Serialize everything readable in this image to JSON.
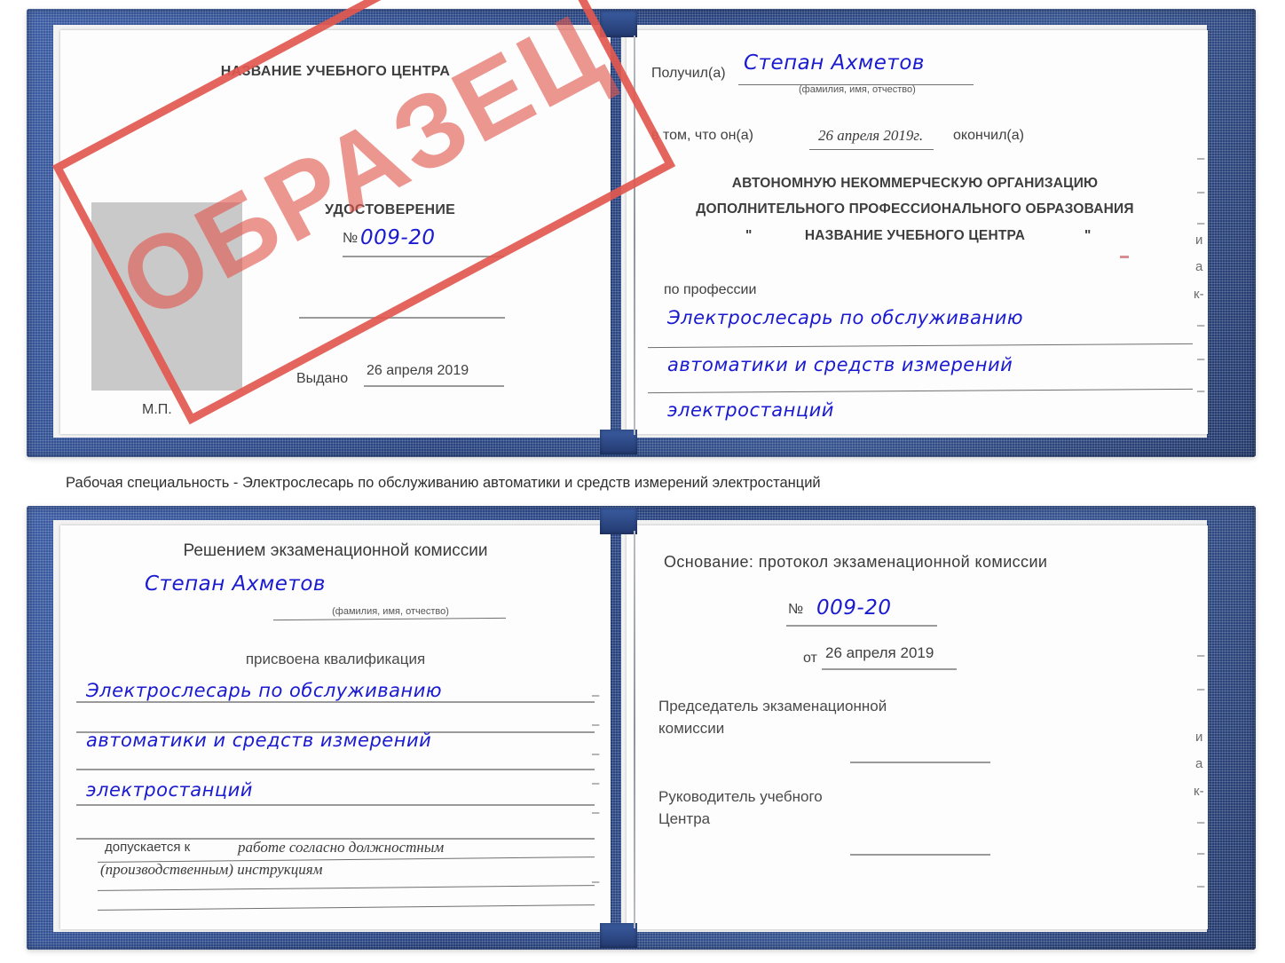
{
  "caption": "Рабочая специальность - Электрослесарь по обслуживанию автоматики и средств измерений электростанций",
  "stamp": {
    "text": "ОБРАЗЕЦ",
    "color": "#e2584f"
  },
  "colors": {
    "cover": "#2e4d8e",
    "handwriting": "#1a1ad0",
    "page": "#fdfdfd",
    "photo_placeholder": "#c9c9c9"
  },
  "doc_top": {
    "left_page": {
      "center_name": "НАЗВАНИЕ УЧЕБНОГО ЦЕНТРА",
      "title": "УДОСТОВЕРЕНИЕ",
      "number_label": "№",
      "number_value": "009-20",
      "issued_label": "Выдано",
      "issued_value": "26 апреля 2019",
      "seal_label": "М.П.",
      "photo_label": "photo-placeholder"
    },
    "right_page": {
      "received_label": "Получил(а)",
      "received_value": "Степан Ахметов",
      "fio_hint": "(фамилия, имя, отчество)",
      "in_that_label": "в том, что он(а)",
      "date_value": "26 апреля 2019г.",
      "finished_label": "окончил(а)",
      "org_line1": "АВТОНОМНУЮ НЕКОММЕРЧЕСКУЮ ОРГАНИЗАЦИЮ",
      "org_line2": "ДОПОЛНИТЕЛЬНОГО ПРОФЕССИОНАЛЬНОГО ОБРАЗОВАНИЯ",
      "org_quote_open": "\"",
      "org_line3": "НАЗВАНИЕ УЧЕБНОГО ЦЕНТРА",
      "org_quote_close": "\"",
      "profession_label": "по профессии",
      "profession_line1": "Электрослесарь по обслуживанию",
      "profession_line2": "автоматики и средств измерений",
      "profession_line3": "электростанций",
      "edge_marks": [
        "–",
        "–",
        "–",
        "и",
        "а",
        "к-",
        "–",
        "–",
        "–"
      ]
    }
  },
  "doc_bottom": {
    "left_page": {
      "decision_title": "Решением экзаменационной комиссии",
      "name_value": "Степан Ахметов",
      "fio_hint": "(фамилия, имя, отчество)",
      "qualification_label": "присвоена квалификация",
      "qualification_line1": "Электрослесарь по обслуживанию",
      "qualification_line2": "автоматики и средств измерений",
      "qualification_line3": "электростанций",
      "allowed_label": "допускается к",
      "allowed_value1": "работе согласно должностным",
      "allowed_value2": "(производственным) инструкциям"
    },
    "right_page": {
      "basis_label": "Основание: протокол экзаменационной комиссии",
      "number_label": "№",
      "number_value": "009-20",
      "from_label": "от",
      "from_value": "26 апреля 2019",
      "chairman_line1": "Председатель экзаменационной",
      "chairman_line2": "комиссии",
      "head_line1": "Руководитель учебного",
      "head_line2": "Центра",
      "edge_marks": [
        "–",
        "–",
        "и",
        "а",
        "к-",
        "–",
        "–",
        "–"
      ]
    }
  }
}
